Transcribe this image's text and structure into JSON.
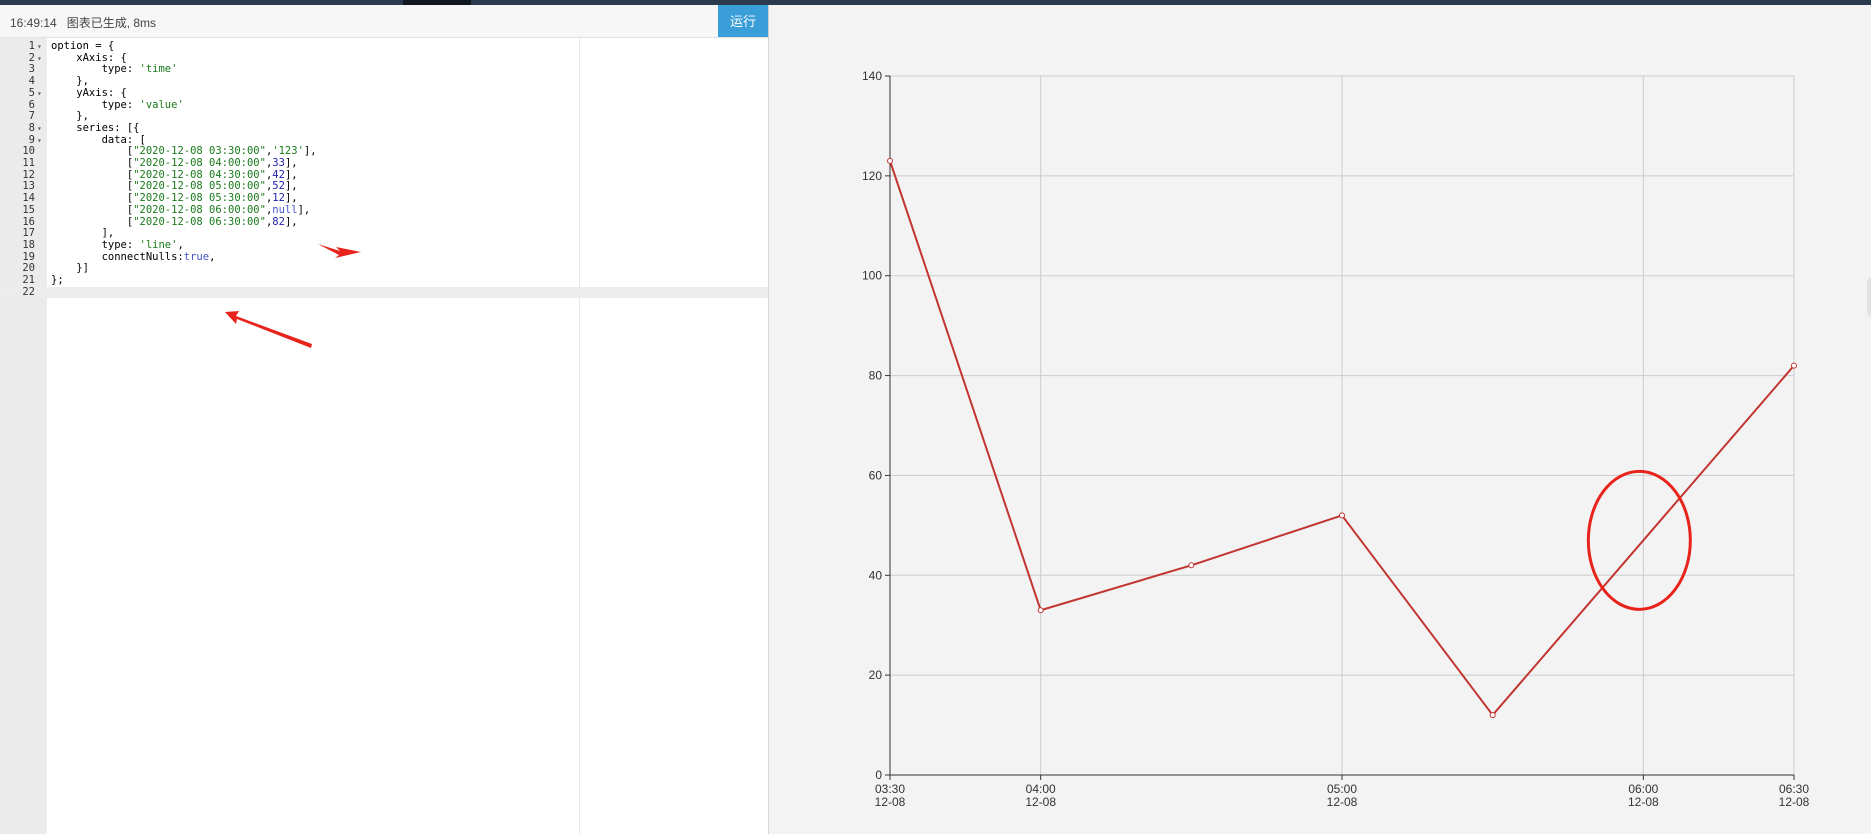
{
  "status": {
    "time": "16:49:14",
    "message": "图表已生成, 8ms",
    "run_label": "运行"
  },
  "code_lines": [
    {
      "n": "1",
      "fold": true,
      "parts": [
        [
          "p",
          "option = {"
        ]
      ]
    },
    {
      "n": "2",
      "fold": true,
      "parts": [
        [
          "p",
          "    xAxis: {"
        ]
      ]
    },
    {
      "n": "3",
      "fold": false,
      "parts": [
        [
          "p",
          "        type: "
        ],
        [
          "s",
          "'time'"
        ]
      ]
    },
    {
      "n": "4",
      "fold": false,
      "parts": [
        [
          "p",
          "    },"
        ]
      ]
    },
    {
      "n": "5",
      "fold": true,
      "parts": [
        [
          "p",
          "    yAxis: {"
        ]
      ]
    },
    {
      "n": "6",
      "fold": false,
      "parts": [
        [
          "p",
          "        type: "
        ],
        [
          "s",
          "'value'"
        ]
      ]
    },
    {
      "n": "7",
      "fold": false,
      "parts": [
        [
          "p",
          "    },"
        ]
      ]
    },
    {
      "n": "8",
      "fold": true,
      "parts": [
        [
          "p",
          "    series: [{"
        ]
      ]
    },
    {
      "n": "9",
      "fold": true,
      "parts": [
        [
          "p",
          "        data: ["
        ]
      ]
    },
    {
      "n": "10",
      "fold": false,
      "parts": [
        [
          "p",
          "            ["
        ],
        [
          "s",
          "\"2020-12-08 03:30:00\""
        ],
        [
          "p",
          ","
        ],
        [
          "s",
          "'123'"
        ],
        [
          "p",
          "],"
        ]
      ]
    },
    {
      "n": "11",
      "fold": false,
      "parts": [
        [
          "p",
          "            ["
        ],
        [
          "s",
          "\"2020-12-08 04:00:00\""
        ],
        [
          "p",
          ","
        ],
        [
          "n",
          "33"
        ],
        [
          "p",
          "],"
        ]
      ]
    },
    {
      "n": "12",
      "fold": false,
      "parts": [
        [
          "p",
          "            ["
        ],
        [
          "s",
          "\"2020-12-08 04:30:00\""
        ],
        [
          "p",
          ","
        ],
        [
          "n",
          "42"
        ],
        [
          "p",
          "],"
        ]
      ]
    },
    {
      "n": "13",
      "fold": false,
      "parts": [
        [
          "p",
          "            ["
        ],
        [
          "s",
          "\"2020-12-08 05:00:00\""
        ],
        [
          "p",
          ","
        ],
        [
          "n",
          "52"
        ],
        [
          "p",
          "],"
        ]
      ]
    },
    {
      "n": "14",
      "fold": false,
      "parts": [
        [
          "p",
          "            ["
        ],
        [
          "s",
          "\"2020-12-08 05:30:00\""
        ],
        [
          "p",
          ","
        ],
        [
          "n",
          "12"
        ],
        [
          "p",
          "],"
        ]
      ]
    },
    {
      "n": "15",
      "fold": false,
      "parts": [
        [
          "p",
          "            ["
        ],
        [
          "s",
          "\"2020-12-08 06:00:00\""
        ],
        [
          "p",
          ","
        ],
        [
          "k",
          "null"
        ],
        [
          "p",
          "],"
        ]
      ]
    },
    {
      "n": "16",
      "fold": false,
      "parts": [
        [
          "p",
          "            ["
        ],
        [
          "s",
          "\"2020-12-08 06:30:00\""
        ],
        [
          "p",
          ","
        ],
        [
          "n",
          "82"
        ],
        [
          "p",
          "],"
        ]
      ]
    },
    {
      "n": "17",
      "fold": false,
      "parts": [
        [
          "p",
          "        ],"
        ]
      ]
    },
    {
      "n": "18",
      "fold": false,
      "parts": [
        [
          "p",
          "        type: "
        ],
        [
          "s",
          "'line'"
        ],
        [
          "p",
          ","
        ]
      ]
    },
    {
      "n": "19",
      "fold": false,
      "parts": [
        [
          "p",
          "        connectNulls:"
        ],
        [
          "k",
          "true"
        ],
        [
          "p",
          ","
        ]
      ]
    },
    {
      "n": "20",
      "fold": false,
      "parts": [
        [
          "p",
          "    }]"
        ]
      ]
    },
    {
      "n": "21",
      "fold": false,
      "parts": [
        [
          "p",
          "};"
        ]
      ]
    },
    {
      "n": "22",
      "fold": false,
      "parts": [
        [
          "p",
          ""
        ]
      ],
      "active": true
    }
  ],
  "chart_data": {
    "type": "line",
    "x": [
      "2020-12-08 03:30:00",
      "2020-12-08 04:00:00",
      "2020-12-08 04:30:00",
      "2020-12-08 05:00:00",
      "2020-12-08 05:30:00",
      "2020-12-08 06:00:00",
      "2020-12-08 06:30:00"
    ],
    "values": [
      123,
      33,
      42,
      52,
      12,
      null,
      82
    ],
    "connect_nulls": true,
    "ylim": [
      0,
      140
    ],
    "y_ticks": [
      0,
      20,
      40,
      60,
      80,
      100,
      120,
      140
    ],
    "x_ticks": [
      {
        "time": "2020-12-08 03:30:00",
        "line1": "03:30",
        "line2": "12-08"
      },
      {
        "time": "2020-12-08 04:00:00",
        "line1": "04:00",
        "line2": "12-08"
      },
      {
        "time": "2020-12-08 05:00:00",
        "line1": "05:00",
        "line2": "12-08"
      },
      {
        "time": "2020-12-08 06:00:00",
        "line1": "06:00",
        "line2": "12-08"
      },
      {
        "time": "2020-12-08 06:30:00",
        "line1": "06:30",
        "line2": "12-08"
      }
    ],
    "grid": true,
    "line_color": "#c23531",
    "annotation_color": "#e8231b"
  }
}
